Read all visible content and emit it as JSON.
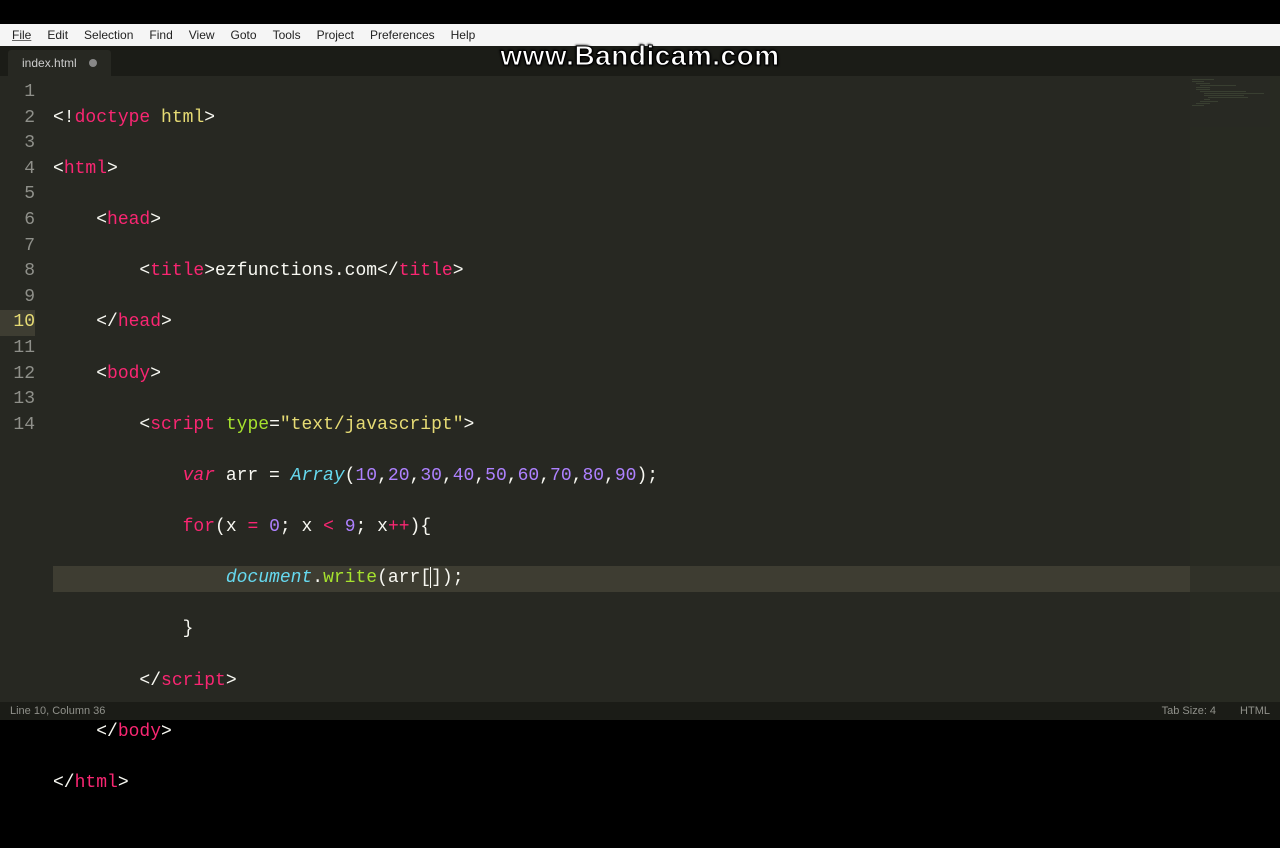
{
  "menu": {
    "items": [
      "File",
      "Edit",
      "Selection",
      "Find",
      "View",
      "Goto",
      "Tools",
      "Project",
      "Preferences",
      "Help"
    ]
  },
  "tab": {
    "name": "index.html",
    "dirty": true
  },
  "watermark": "www.Bandicam.com",
  "gutter": [
    "1",
    "2",
    "3",
    "4",
    "5",
    "6",
    "7",
    "8",
    "9",
    "10",
    "11",
    "12",
    "13",
    "14"
  ],
  "code": {
    "l1": {
      "a": "<!",
      "b": "doctype",
      "c": " ",
      "d": "html",
      "e": ">"
    },
    "l2": {
      "a": "<",
      "b": "html",
      "c": ">"
    },
    "l3": {
      "a": "    <",
      "b": "head",
      "c": ">"
    },
    "l4": {
      "a": "        <",
      "b": "title",
      "c": ">",
      "d": "ezfunctions.com",
      "e": "</",
      "f": "title",
      "g": ">"
    },
    "l5": {
      "a": "    </",
      "b": "head",
      "c": ">"
    },
    "l6": {
      "a": "    <",
      "b": "body",
      "c": ">"
    },
    "l7": {
      "a": "        <",
      "b": "script",
      "c": " ",
      "d": "type",
      "e": "=",
      "f": "\"text/javascript\"",
      "g": ">"
    },
    "l8": {
      "a": "            ",
      "b": "var",
      "c": " arr = ",
      "d": "Array",
      "e": "(",
      "n1": "10",
      "p1": ",",
      "n2": "20",
      "p2": ",",
      "n3": "30",
      "p3": ",",
      "n4": "40",
      "p4": ",",
      "n5": "50",
      "p5": ",",
      "n6": "60",
      "p6": ",",
      "n7": "70",
      "p7": ",",
      "n8": "80",
      "p8": ",",
      "n9": "90",
      "f": ");"
    },
    "l9": {
      "a": "            ",
      "b": "for",
      "c": "(x ",
      "d": "=",
      "e": " ",
      "n0": "0",
      "f": "; x ",
      "g": "<",
      "h": " ",
      "n9": "9",
      "i": "; x",
      "j": "++",
      "k": "){"
    },
    "l10": {
      "a": "                ",
      "b": "document",
      "c": ".",
      "d": "write",
      "e": "(arr[",
      "f": "]);"
    },
    "l11": {
      "a": "            }"
    },
    "l12": {
      "a": "        </",
      "b": "script",
      "c": ">"
    },
    "l13": {
      "a": "    </",
      "b": "body",
      "c": ">"
    },
    "l14": {
      "a": "</",
      "b": "html",
      "c": ">"
    }
  },
  "status": {
    "left": "Line 10, Column 36",
    "tabsize": "Tab Size: 4",
    "lang": "HTML"
  }
}
